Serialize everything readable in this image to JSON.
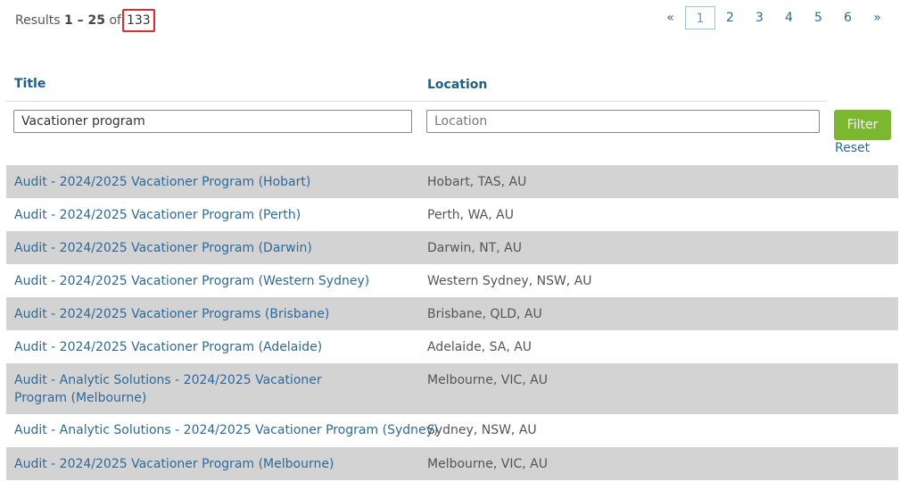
{
  "results": {
    "prefix": "Results",
    "range": "1 – 25",
    "of_label": "of",
    "total": "133"
  },
  "pagination": {
    "prev": "«",
    "pages": [
      "1",
      "2",
      "3",
      "4",
      "5",
      "6"
    ],
    "current": "1",
    "next": "»"
  },
  "columns": {
    "title": "Title",
    "location": "Location"
  },
  "filters": {
    "title_value": "Vacationer program",
    "location_placeholder": "Location",
    "filter_label": "Filter",
    "reset_label": "Reset"
  },
  "rows": [
    {
      "title": "Audit - 2024/2025 Vacationer Program (Hobart)",
      "location": "Hobart, TAS, AU"
    },
    {
      "title": "Audit - 2024/2025 Vacationer Program (Perth)",
      "location": "Perth, WA, AU"
    },
    {
      "title": "Audit - 2024/2025 Vacationer Program (Darwin)",
      "location": "Darwin, NT, AU"
    },
    {
      "title": "Audit - 2024/2025 Vacationer Program (Western Sydney)",
      "location": "Western Sydney, NSW, AU"
    },
    {
      "title": "Audit - 2024/2025 Vacationer Programs (Brisbane)",
      "location": "Brisbane, QLD, AU"
    },
    {
      "title": "Audit - 2024/2025 Vacationer Program (Adelaide)",
      "location": "Adelaide, SA, AU"
    },
    {
      "title": "Audit - Analytic Solutions - 2024/2025 Vacationer Program (Melbourne)",
      "location": "Melbourne, VIC, AU"
    },
    {
      "title": "Audit - Analytic Solutions - 2024/2025 Vacationer Program (Sydney)",
      "location": "Sydney, NSW, AU"
    },
    {
      "title": "Audit - 2024/2025 Vacationer Program (Melbourne)",
      "location": "Melbourne, VIC, AU"
    }
  ],
  "colors": {
    "link": "#2a6b9c",
    "header": "#1f5f8b",
    "shaded_row": "#d3d3d3",
    "filter_button": "#7cb82f",
    "highlight_border": "#e02b2b"
  }
}
